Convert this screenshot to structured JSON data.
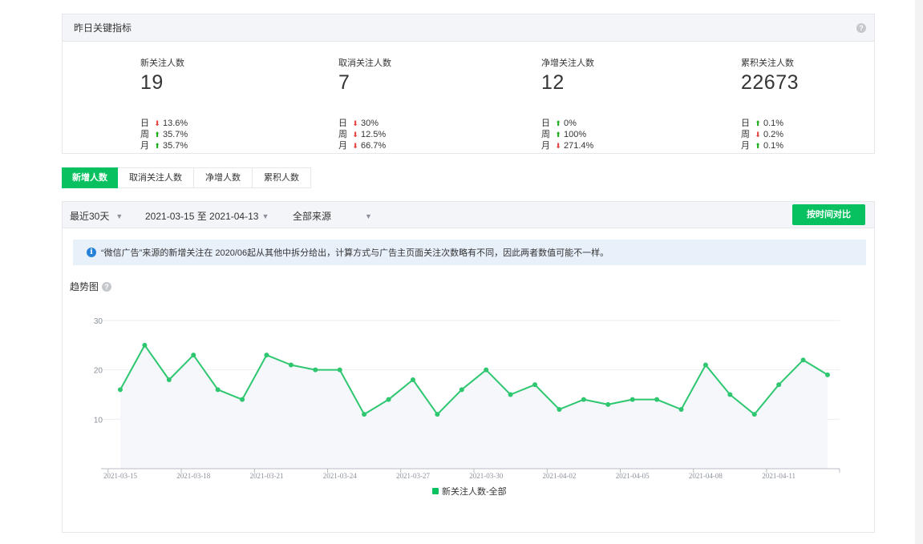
{
  "kpi": {
    "title": "昨日关键指标",
    "help_glyph": "?",
    "columns": [
      {
        "label": "新关注人数",
        "value": "19",
        "rows": [
          {
            "period": "日",
            "dir": "down",
            "pct": "13.6%"
          },
          {
            "period": "周",
            "dir": "up",
            "pct": "35.7%"
          },
          {
            "period": "月",
            "dir": "up",
            "pct": "35.7%"
          }
        ]
      },
      {
        "label": "取消关注人数",
        "value": "7",
        "rows": [
          {
            "period": "日",
            "dir": "down",
            "pct": "30%"
          },
          {
            "period": "周",
            "dir": "down",
            "pct": "12.5%"
          },
          {
            "period": "月",
            "dir": "down",
            "pct": "66.7%"
          }
        ]
      },
      {
        "label": "净增关注人数",
        "value": "12",
        "rows": [
          {
            "period": "日",
            "dir": "up",
            "pct": "0%"
          },
          {
            "period": "周",
            "dir": "up",
            "pct": "100%"
          },
          {
            "period": "月",
            "dir": "down",
            "pct": "271.4%"
          }
        ]
      },
      {
        "label": "累积关注人数",
        "value": "22673",
        "rows": [
          {
            "period": "日",
            "dir": "up",
            "pct": "0.1%"
          },
          {
            "period": "周",
            "dir": "down",
            "pct": "0.2%"
          },
          {
            "period": "月",
            "dir": "up",
            "pct": "0.1%"
          }
        ]
      }
    ]
  },
  "tabs": [
    {
      "label": "新增人数",
      "active": true
    },
    {
      "label": "取消关注人数",
      "active": false
    },
    {
      "label": "净增人数",
      "active": false
    },
    {
      "label": "累积人数",
      "active": false
    }
  ],
  "filters": {
    "range": "最近30天",
    "dates": "2021-03-15 至 2021-04-13",
    "source": "全部来源",
    "compare_button": "按时间对比"
  },
  "notice": {
    "icon_glyph": "i",
    "text": "“微信广告”来源的新增关注在 2020/06起从其他中拆分给出，计算方式与广告主页面关注次数略有不同，因此两者数值可能不一样。"
  },
  "trend_title": "趋势图",
  "colors": {
    "accent": "#07c160",
    "up": "#1aad19",
    "down": "#e64340",
    "line": "#2ec770",
    "info": "#2782d7"
  },
  "chart_data": {
    "type": "line",
    "title": "",
    "xlabel": "",
    "ylabel": "",
    "ylim": [
      0,
      30
    ],
    "yticks": [
      10,
      20,
      30
    ],
    "grid": true,
    "legend": "bottom-center",
    "x": [
      "2021-03-15",
      "2021-03-16",
      "2021-03-17",
      "2021-03-18",
      "2021-03-19",
      "2021-03-20",
      "2021-03-21",
      "2021-03-22",
      "2021-03-23",
      "2021-03-24",
      "2021-03-25",
      "2021-03-26",
      "2021-03-27",
      "2021-03-28",
      "2021-03-29",
      "2021-03-30",
      "2021-03-31",
      "2021-04-01",
      "2021-04-02",
      "2021-04-03",
      "2021-04-04",
      "2021-04-05",
      "2021-04-06",
      "2021-04-07",
      "2021-04-08",
      "2021-04-09",
      "2021-04-10",
      "2021-04-11",
      "2021-04-12",
      "2021-04-13"
    ],
    "x_tick_labels": [
      "2021-03-15",
      "2021-03-18",
      "2021-03-21",
      "2021-03-24",
      "2021-03-27",
      "2021-03-30",
      "2021-04-02",
      "2021-04-05",
      "2021-04-08",
      "2021-04-11"
    ],
    "series": [
      {
        "name": "新关注人数-全部",
        "values": [
          16,
          25,
          18,
          23,
          16,
          14,
          23,
          21,
          20,
          20,
          11,
          14,
          18,
          11,
          16,
          20,
          15,
          17,
          12,
          14,
          13,
          14,
          14,
          12,
          21,
          15,
          11,
          17,
          22,
          19
        ]
      }
    ]
  }
}
